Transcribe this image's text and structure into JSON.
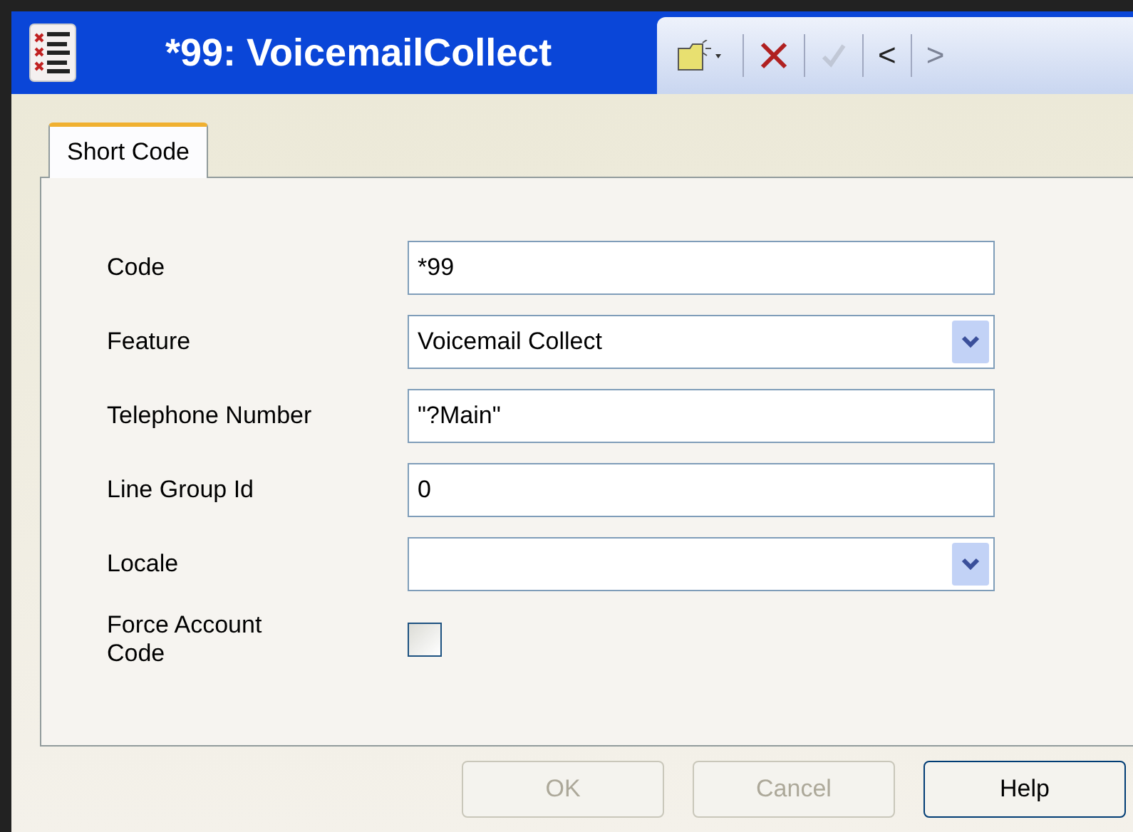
{
  "window": {
    "title": "*99: VoicemailCollect"
  },
  "toolbar": [
    {
      "kind": "new",
      "disabled": false
    },
    {
      "kind": "delete",
      "disabled": false
    },
    {
      "kind": "check",
      "disabled": true
    },
    {
      "kind": "text",
      "label": "<",
      "disabled": false
    },
    {
      "kind": "text",
      "label": ">",
      "disabled": true
    }
  ],
  "tabs": [
    {
      "label": "Short Code",
      "selected": true
    }
  ],
  "fields": [
    {
      "kind": "text",
      "label": "Code",
      "value": "*99"
    },
    {
      "kind": "dropdown",
      "label": "Feature",
      "value": "Voicemail Collect"
    },
    {
      "kind": "text",
      "label": "Telephone Number",
      "value": "\"?Main\""
    },
    {
      "kind": "text",
      "label": "Line Group Id",
      "value": "0"
    },
    {
      "kind": "dropdown",
      "label": "Locale"
    },
    {
      "kind": "checkbox",
      "label": "Force Account Code",
      "checked": false
    }
  ],
  "buttons": [
    {
      "label": "OK",
      "disabled": true
    },
    {
      "label": "Cancel",
      "disabled": true
    },
    {
      "label": "Help",
      "disabled": false
    }
  ]
}
